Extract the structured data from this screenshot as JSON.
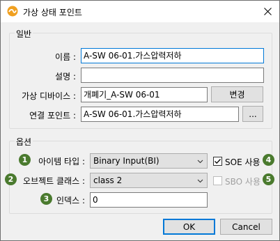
{
  "window": {
    "title": "가상 상태 포인트",
    "close_glyph": "✕"
  },
  "general": {
    "group_label": "일반",
    "name_label": "이름 :",
    "name_value": "A-SW 06-01.가스압력저하",
    "desc_label": "설명 :",
    "desc_value": "",
    "device_label": "가상 디바이스 :",
    "device_value": "개폐기_A-SW 06-01",
    "change_button": "변경",
    "link_label": "연결 포인트 :",
    "link_value": "A-SW 06-01.가스압력저하",
    "browse_button": "..."
  },
  "options": {
    "group_label": "옵션",
    "item_type_label": "아이템 타입 :",
    "item_type_value": "Binary Input(BI)",
    "object_class_label": "오브젝트 클래스 :",
    "object_class_value": "class 2",
    "index_label": "인덱스 :",
    "index_value": "0",
    "soe_label": "SOE 사용",
    "soe_checked": true,
    "sbo_label": "SBO 사용",
    "sbo_checked": false,
    "sbo_enabled": false
  },
  "badges": [
    "1",
    "2",
    "3",
    "4",
    "5"
  ],
  "footer": {
    "ok_button": "OK",
    "cancel_button": "Cancel"
  },
  "colors": {
    "badge": "#4a7a2e",
    "focus_border": "#0078d7",
    "app_icon": "#f0a020"
  }
}
